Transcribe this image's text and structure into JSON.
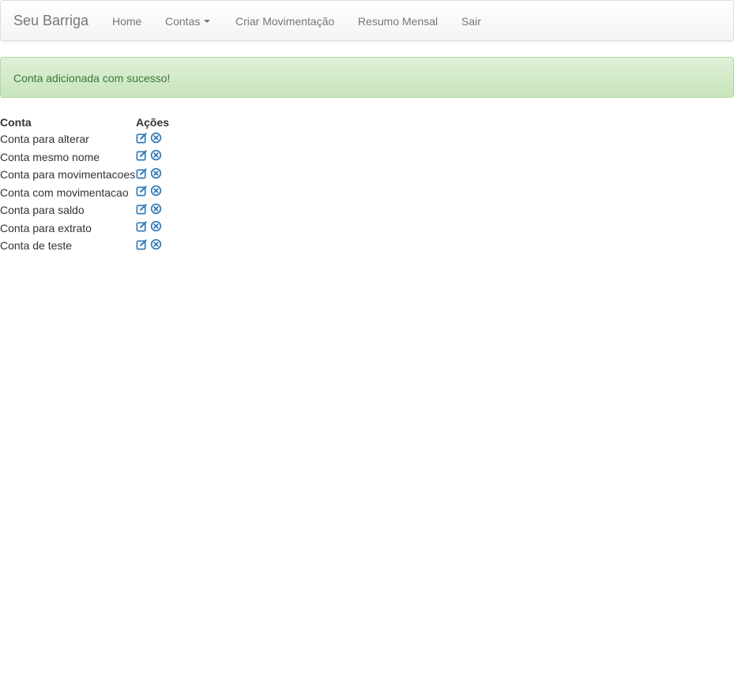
{
  "navbar": {
    "brand": "Seu Barriga",
    "items": [
      {
        "label": "Home"
      },
      {
        "label": "Contas",
        "dropdown": true
      },
      {
        "label": "Criar Movimentação"
      },
      {
        "label": "Resumo Mensal"
      },
      {
        "label": "Sair"
      }
    ]
  },
  "alert": {
    "message": "Conta adicionada com sucesso!"
  },
  "table": {
    "headers": {
      "conta": "Conta",
      "acoes": "Ações"
    },
    "rows": [
      {
        "conta": "Conta para alterar",
        "actions": [
          "edit-icon",
          "remove-icon"
        ]
      },
      {
        "conta": "Conta mesmo nome",
        "actions": [
          "edit-icon",
          "remove-icon"
        ]
      },
      {
        "conta": "Conta para movimentacoes",
        "actions": [
          "edit-icon",
          "remove-icon"
        ]
      },
      {
        "conta": "Conta com movimentacao",
        "actions": [
          "edit-icon",
          "remove-icon"
        ]
      },
      {
        "conta": "Conta para saldo",
        "actions": [
          "edit-icon",
          "remove-icon"
        ]
      },
      {
        "conta": "Conta para extrato",
        "actions": [
          "edit-icon",
          "remove-icon"
        ]
      },
      {
        "conta": "Conta de teste",
        "actions": [
          "edit-icon",
          "remove-icon"
        ]
      }
    ]
  },
  "colors": {
    "icon": "#337ab7",
    "alert_text": "#3c763d",
    "nav_text": "#777777"
  }
}
